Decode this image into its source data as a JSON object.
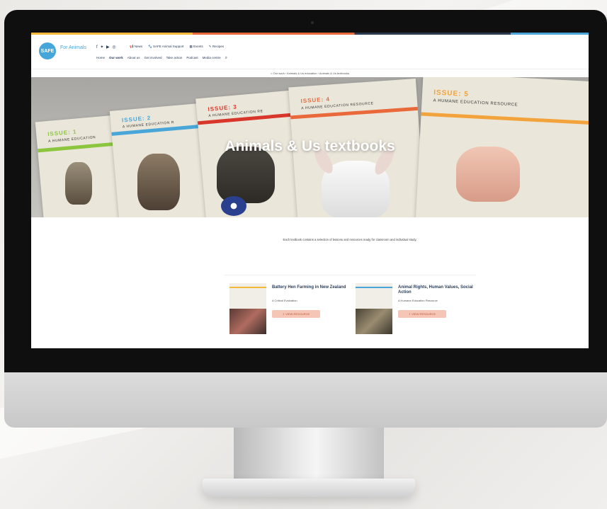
{
  "site": {
    "logo_text": "SAFE",
    "logo_tagline": "For Animals",
    "social_icons": [
      "facebook-icon",
      "twitter-icon",
      "youtube-icon",
      "instagram-icon"
    ],
    "top_links": [
      "News",
      "SAFE Animal Support",
      "Events",
      "Recipes"
    ],
    "nav": [
      "Home",
      "Our work",
      "About us",
      "Get involved",
      "Take action",
      "Podcast",
      "Media centre"
    ],
    "breadcrumb": "Our work › Animals & Us education › Animals & Us textbooks"
  },
  "hero": {
    "title": "Animals & Us textbooks",
    "books": [
      {
        "issue": "ISSUE: 1",
        "subtitle": "A HUMANE EDUCATION"
      },
      {
        "issue": "ISSUE: 2",
        "subtitle": "A HUMANE EDUCATION R"
      },
      {
        "issue": "ISSUE: 3",
        "subtitle": "A HUMANE EDUCATION RE"
      },
      {
        "issue": "ISSUE: 4",
        "subtitle": "A HUMANE EDUCATION RESOURCE"
      },
      {
        "issue": "ISSUE: 5",
        "subtitle": "A HUMANE EDUCATION RESOURCE"
      }
    ]
  },
  "intro": "Each textbook contains a selection of lessons and resources ready for classroom and individual study.",
  "cards": [
    {
      "title": "Battery Hen Farming in New Zealand",
      "subtitle": "A Critical Evaluation",
      "button": "VIEW RESOURCE"
    },
    {
      "title": "Animal Rights, Human Values, Social Action",
      "subtitle": "A Humane Education Resource",
      "button": "VIEW RESOURCE"
    }
  ],
  "colors": {
    "brand": "#46a5d9",
    "navy": "#2c3e57",
    "orange": "#e9693b",
    "yellow": "#f2b93b",
    "button_bg": "#f5c6b6"
  }
}
